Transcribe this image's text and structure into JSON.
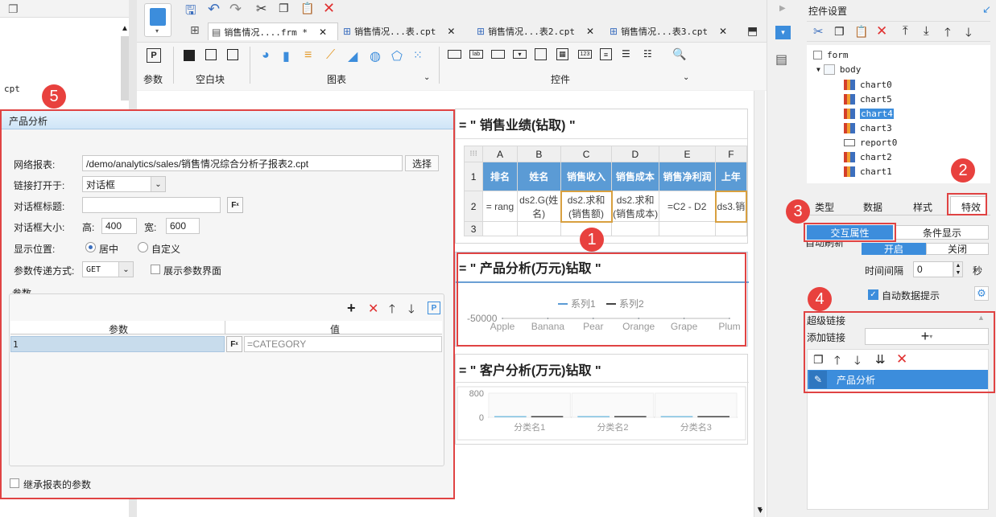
{
  "left_panel": {
    "cpt_label": "cpt"
  },
  "toolbar": {
    "tabs": [
      {
        "label": "销售情况....frm *"
      },
      {
        "label": "销售情况...表.cpt"
      },
      {
        "label": "销售情况...表2.cpt"
      },
      {
        "label": "销售情况...表3.cpt"
      }
    ],
    "groups": {
      "param": "参数",
      "blank": "空白块",
      "chart": "图表",
      "control": "控件"
    }
  },
  "canvas": {
    "report_title": "销售业绩(钻取)",
    "col_letters": [
      "A",
      "B",
      "C",
      "D",
      "E",
      "F"
    ],
    "row_nums": [
      "1",
      "2",
      "3"
    ],
    "headers": [
      "排名",
      "姓名",
      "销售收入",
      "销售成本",
      "销售净利润",
      "上年"
    ],
    "row2": [
      "= rang",
      "ds2.G(姓名)",
      "ds2.求和(销售额)",
      "ds2.求和(销售成本)",
      "=C2 - D2",
      "ds3.销"
    ],
    "chart1_title": "产品分析(万元)钻取",
    "chart1": {
      "legend": [
        "系列1",
        "系列2"
      ],
      "ytick": "-50000"
    },
    "chart2_title": "客户分析(万元)钻取",
    "chart2": {
      "yticks": [
        "800",
        "0"
      ]
    }
  },
  "chart_data": [
    {
      "type": "line",
      "title": "产品分析(万元)钻取",
      "categories": [
        "Apple",
        "Banana",
        "Pear",
        "Orange",
        "Grape",
        "Plum"
      ],
      "series": [
        {
          "name": "系列1",
          "values": [
            0,
            0,
            0,
            0,
            0,
            0
          ]
        },
        {
          "name": "系列2",
          "values": [
            0,
            0,
            0,
            0,
            0,
            0
          ]
        }
      ],
      "yticks": [
        -50000
      ]
    },
    {
      "type": "bar",
      "title": "客户分析(万元)钻取",
      "categories": [
        "分类名1",
        "分类名2",
        "分类名3"
      ],
      "series": [
        {
          "values": [
            1,
            1,
            1
          ]
        },
        {
          "values": [
            1,
            1,
            1
          ]
        }
      ],
      "ylim": [
        0,
        800
      ]
    }
  ],
  "dialog": {
    "title": "产品分析",
    "net_report_label": "网络报表:",
    "net_report_value": "/demo/analytics/sales/销售情况综合分析子报表2.cpt",
    "select_button": "选择",
    "open_in_label": "链接打开于:",
    "open_in_value": "对话框",
    "dialog_title_label": "对话框标题:",
    "dialog_size_label": "对话框大小:",
    "height_label": "高:",
    "height_value": "400",
    "width_label": "宽:",
    "width_value": "600",
    "position_label": "显示位置:",
    "center_option": "居中",
    "custom_option": "自定义",
    "transfer_label": "参数传递方式:",
    "transfer_value": "GET",
    "show_param_ui": "展示参数界面",
    "params_section": "参数",
    "param_col": "参数",
    "value_col": "值",
    "param_row_index": "1",
    "param_row_value": "=CATEGORY",
    "inherit_params": "继承报表的参数"
  },
  "right_panel": {
    "title": "控件设置",
    "tree": [
      {
        "label": "form",
        "kind": "form"
      },
      {
        "label": "body",
        "kind": "body"
      },
      {
        "label": "chart0",
        "kind": "chart"
      },
      {
        "label": "chart5",
        "kind": "chart"
      },
      {
        "label": "chart4",
        "kind": "chart",
        "selected": true
      },
      {
        "label": "chart3",
        "kind": "chart"
      },
      {
        "label": "report0",
        "kind": "report"
      },
      {
        "label": "chart2",
        "kind": "chart"
      },
      {
        "label": "chart1",
        "kind": "chart"
      }
    ],
    "tabs": [
      "类型",
      "数据",
      "样式",
      "特效"
    ],
    "subtabs": [
      "交互属性",
      "条件显示"
    ],
    "auto_refresh_label": "自动刷新",
    "toggle_on": "开启",
    "toggle_off": "关闭",
    "interval_label": "时间间隔",
    "interval_value": "0",
    "interval_unit": "秒",
    "auto_tip_label": "自动数据提示",
    "hyperlink_label": "超级链接",
    "add_link_label": "添加链接",
    "link_item": "产品分析"
  },
  "badges": [
    "1",
    "2",
    "3",
    "4",
    "5"
  ],
  "colors": {
    "accent": "#3c8ddc",
    "highlight_box": "#e04343",
    "header_blue": "#5b9bd5"
  }
}
